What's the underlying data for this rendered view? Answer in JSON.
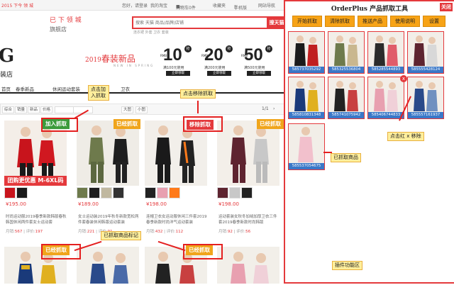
{
  "topnav": {
    "greeting": "2015   下今 领 城",
    "hello": "您好，请登录",
    "my_taobao": "我的淘宝",
    "cart": "购物车0件",
    "favorites": "收藏夹",
    "mobile": "手机版",
    "site_nav": "网站导航"
  },
  "store": {
    "title_line1": "已 下 领 城",
    "title_line2": "旗舰店",
    "logo_letter": "G",
    "logo_sub": "装店",
    "spring_year": "2019",
    "spring_text": "春装新品",
    "spring_en": "NEW  IN  SPRING"
  },
  "search": {
    "placeholder": "搜索 天猫 商品/品牌/店铺",
    "button": "搜天猫",
    "hot": "连衣裙  外套  卫衣  套装"
  },
  "coupons": [
    {
      "amount": "10",
      "tag": "抢",
      "cond": "满100元使用",
      "btn": "立即领取"
    },
    {
      "amount": "20",
      "tag": "抢",
      "cond": "满200元使用",
      "btn": "立即领取"
    },
    {
      "amount": "50",
      "tag": "抢",
      "cond": "满500元使用",
      "btn": "立即领取"
    }
  ],
  "catnav": [
    "首页",
    "春季新品",
    "休闲运动套装",
    "卫衣"
  ],
  "filters": {
    "sort": [
      "综合",
      "销量",
      "新品",
      "价格"
    ],
    "view_grid": "大图",
    "view_list": "小图",
    "pager": "1/1"
  },
  "products_row1": [
    {
      "badge": "加入抓取",
      "badge_type": "add",
      "promo": "团购更优惠 M-6XL码",
      "price": "¥195.00",
      "title": "时尚运动服2019春季新款韩版春秋韩国休闲两件套女士运动套",
      "sales_label": "月销:",
      "sales": "567",
      "rev_label": "评价:",
      "reviews": "197"
    },
    {
      "badge": "已经抓取",
      "badge_type": "done",
      "promo": "",
      "price": "¥189.00",
      "title": "女士运动装2019年秋冬新款宽松两件套春装休闲韩版运动套装",
      "sales_label": "月销:",
      "sales": "221",
      "rev_label": "评价:",
      "reviews": "91"
    },
    {
      "badge": "移除抓取",
      "badge_type": "remove",
      "promo": "",
      "price": "¥198.00",
      "title": "连帽卫衣女运动服休闲三件套2019春季新款时尚洋气运动套装",
      "sales_label": "月销:",
      "sales": "432",
      "rev_label": "评价:",
      "reviews": "112"
    },
    {
      "badge": "已经抓取",
      "badge_type": "done",
      "promo": "",
      "price": "¥198.00",
      "title": "运动套装女秋冬加绒加厚卫衣三件套2019春季新款时尚韩版",
      "sales_label": "月销:",
      "sales": "92",
      "rev_label": "评价:",
      "reviews": "56"
    }
  ],
  "products_row2": [
    {
      "badge": "已经抓取",
      "badge_type": "done"
    },
    {
      "badge": "",
      "badge_type": ""
    },
    {
      "badge": "已经抓取",
      "badge_type": "done"
    },
    {
      "badge": "",
      "badge_type": ""
    }
  ],
  "annotations": {
    "click_add": "点击加入抓取",
    "click_remove": "点击移除抓取",
    "captured_mark": "已抓取商品标记",
    "click_x": "点击红 x 移除",
    "captured_items": "已抓取商品",
    "plugin_area": "插件功能区"
  },
  "panel": {
    "title": "OrderPlus 产品抓取工具",
    "close": "关闭",
    "buttons": [
      "开始抓取",
      "清除抓取",
      "推送产品",
      "使用说明",
      "设置"
    ],
    "items": [
      {
        "sku": "585737035292",
        "colors": [
          "#1b1b1b",
          "#c02020"
        ]
      },
      {
        "sku": "585325536804",
        "colors": [
          "#6e7a4c",
          "#c9b78f"
        ]
      },
      {
        "sku": "585285544893",
        "colors": [
          "#2b2b2b",
          "#e05c6a"
        ]
      },
      {
        "sku": "585555428124",
        "colors": [
          "#5e2430",
          "#d8d8d8"
        ]
      },
      {
        "sku": "585810831348",
        "colors": [
          "#1a3a7a",
          "#e0b020"
        ]
      },
      {
        "sku": "585741075942",
        "colors": [
          "#222",
          "#c84040"
        ]
      },
      {
        "sku": "585406744833",
        "colors": [
          "#e8a0b0",
          "#f0d0d8"
        ]
      },
      {
        "sku": "585557161937",
        "colors": [
          "#2a4a8a",
          "#7090c0"
        ]
      },
      {
        "sku": "585537054675",
        "colors": [
          "#f2c0cc",
          "#e8e0e0"
        ]
      }
    ],
    "remove_x": "x"
  }
}
